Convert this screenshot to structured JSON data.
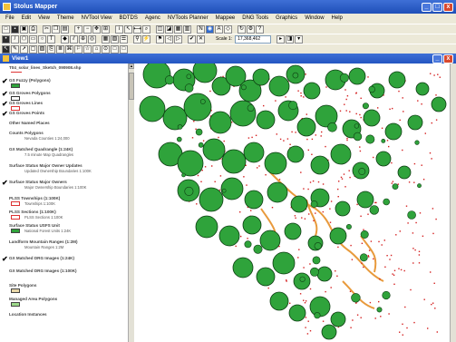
{
  "window": {
    "title": "Stolus Mapper",
    "min_label": "_",
    "max_label": "□",
    "close_label": "x"
  },
  "menu": [
    "File",
    "Edit",
    "View",
    "Theme",
    "NVTool View",
    "BDTDS",
    "Agenc",
    "NVTools Planner",
    "Mappee",
    "DNG Tools",
    "Graphics",
    "Window",
    "Help"
  ],
  "toolbar": {
    "scale_label": "Scale 1:",
    "scale_value": "17,368,462"
  },
  "view": {
    "title": "View1"
  },
  "toc": {
    "layers": [
      {
        "name": "T04_solar_lines_Sketch_090908.shp",
        "checked": false,
        "symbol": "line"
      },
      {
        "name": "GS Fuzzy (Polygons)",
        "checked": true,
        "symbol": "green"
      },
      {
        "name": "GS Groves Polygons",
        "checked": true,
        "symbol": "outline"
      },
      {
        "name": "GS Groves Lines",
        "checked": true,
        "symbol": "redline"
      },
      {
        "name": "GS Groves Points",
        "checked": true,
        "symbol": "none"
      },
      {
        "name": "Other Named Places",
        "checked": false,
        "symbol": "none"
      },
      {
        "name": "Counts Polygons",
        "checked": false,
        "symbol": "none",
        "sub": "Nevada Counties 1:24,000"
      },
      {
        "name": "GX Matched Quadrangle (1:24K)",
        "checked": false,
        "symbol": "none",
        "sub": "7.5 minute Map Quadrangles"
      },
      {
        "name": "Surface Status Major Owner Updates",
        "checked": false,
        "symbol": "none",
        "sub": "Updated Ownership Boundaries 1:100K"
      },
      {
        "name": "Surface Status Major Owners",
        "checked": true,
        "symbol": "none",
        "sub": "Major Ownership Boundaries 1:100K"
      },
      {
        "name": "PLSS Townships (1:100K)",
        "checked": false,
        "symbol": "redline",
        "sub": "Townships 1:100K"
      },
      {
        "name": "PLSS Sections (1:100K)",
        "checked": false,
        "symbol": "redline",
        "sub": "PLSS Sections 1:100K"
      },
      {
        "name": "Surface Status USFS Unit",
        "checked": false,
        "symbol": "green",
        "sub": "National Forest Units 1:24K"
      },
      {
        "name": "Landform Mountain Ranges (1:2M)",
        "checked": false,
        "symbol": "none",
        "sub": "Mountain Ranges 1:2M"
      },
      {
        "name": "GX Matched DRG Images (1:24K)",
        "checked": true,
        "symbol": "none"
      },
      {
        "name": "GX Matched DRG Images (1:100K)",
        "checked": false,
        "symbol": "none"
      },
      {
        "name": "Site Polygons",
        "checked": false,
        "symbol": "tan"
      },
      {
        "name": "Managed Area Polygons",
        "checked": false,
        "symbol": "lightgreen"
      },
      {
        "name": "Location Instances",
        "checked": false,
        "symbol": "none"
      }
    ]
  },
  "colors": {
    "title_blue": "#2456c2",
    "circle_fill": "#2fa33b",
    "circle_stroke": "#0d3d12",
    "point_red": "#d42020",
    "polygon_orange": "#e89a3c",
    "chrome_gray": "#ece9d8"
  },
  "icons": [
    "new-icon",
    "open-icon",
    "save-icon",
    "print-icon",
    "zoom-in-icon",
    "zoom-out-icon",
    "pan-icon",
    "identify-icon",
    "select-icon",
    "measure-icon",
    "refresh-icon",
    "help-icon"
  ]
}
